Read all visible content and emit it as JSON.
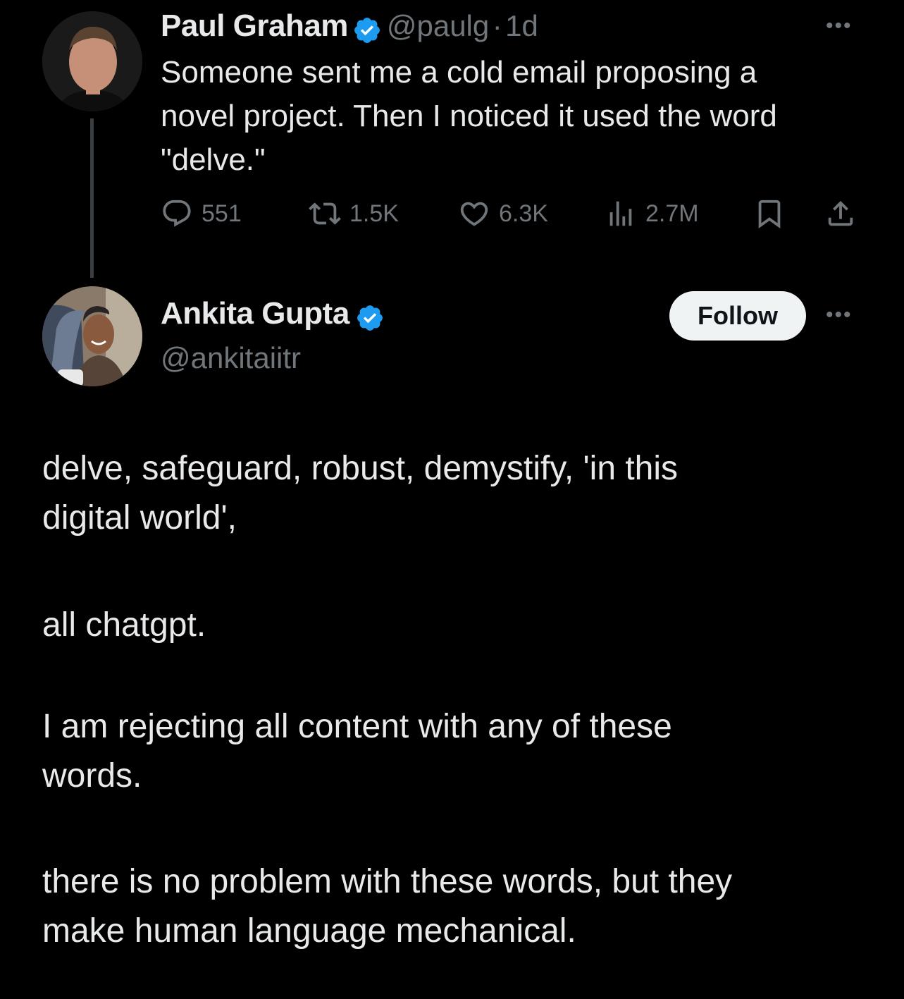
{
  "parent_tweet": {
    "author_name": "Paul Graham",
    "handle": "@paulg",
    "separator": "·",
    "time": "1d",
    "text_lines": [
      "Someone sent me a cold email proposing a",
      "novel project. Then I noticed it used the word",
      "\"delve.\""
    ],
    "stats": {
      "replies": "551",
      "reposts": "1.5K",
      "likes": "6.3K",
      "views": "2.7M"
    },
    "more_label": "•••"
  },
  "reply_tweet": {
    "author_name": "Ankita Gupta",
    "handle": "@ankitaiitr",
    "follow_label": "Follow",
    "more_label": "•••",
    "paragraphs": [
      [
        "delve, safeguard, robust, demystify, 'in this",
        "digital world',"
      ],
      [
        "all chatgpt."
      ],
      [
        "I am rejecting all content with any of these",
        "words."
      ],
      [
        "there is no problem with these words, but they",
        "make human language mechanical."
      ]
    ]
  },
  "colors": {
    "background": "#000000",
    "text": "#e7e9ea",
    "secondary": "#71767b",
    "verified": "#1d9bf0",
    "follow_bg": "#eff3f4"
  },
  "icons": [
    "reply-icon",
    "repost-icon",
    "like-icon",
    "views-icon",
    "bookmark-icon",
    "share-icon",
    "verified-badge-icon",
    "more-icon"
  ]
}
